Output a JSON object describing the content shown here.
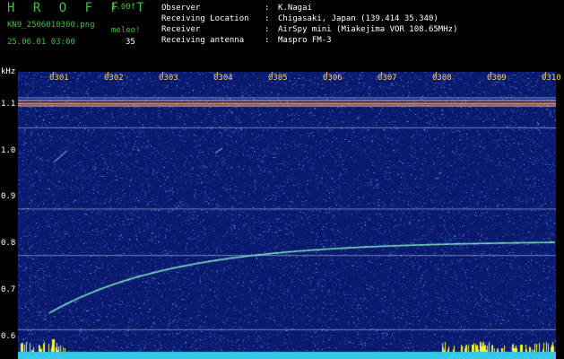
{
  "header": {
    "app_title": "H R O F F T",
    "version": "1.00f",
    "filename": "KN9_2506010300.png",
    "mode": "meleo!",
    "datetime": "25.06.01 03:00",
    "count": "35",
    "info": [
      {
        "label": "Observer",
        "sep": ":",
        "value": "K.Nagai"
      },
      {
        "label": "Receiving Location",
        "sep": ":",
        "value": "Chigasaki, Japan (139.414 35.340)"
      },
      {
        "label": "Receiver",
        "sep": ":",
        "value": "AirSpy mini (Miakejima VOR 108.65MHz)"
      },
      {
        "label": "Receiving antenna",
        "sep": ":",
        "value": "Maspro FM-3"
      }
    ]
  },
  "chart_data": {
    "type": "heatmap",
    "title": "",
    "yunit": "kHz",
    "yticks": [
      "1.1",
      "1.0",
      "0.9",
      "0.8",
      "0.7",
      "0.6"
    ],
    "xticks": [
      "0301",
      "0302",
      "0303",
      "0304",
      "0305",
      "0306",
      "0307",
      "0308",
      "0309",
      "0310"
    ],
    "ylim": [
      0.58,
      1.16
    ],
    "colors": {
      "background": "#0a1a6e",
      "noise": "#3a6cd8",
      "trail": "#7fe0c0",
      "carrier": "#ff8a3a",
      "bottom_bar": "#36c8e8",
      "spikes": "#f2f23a"
    }
  }
}
